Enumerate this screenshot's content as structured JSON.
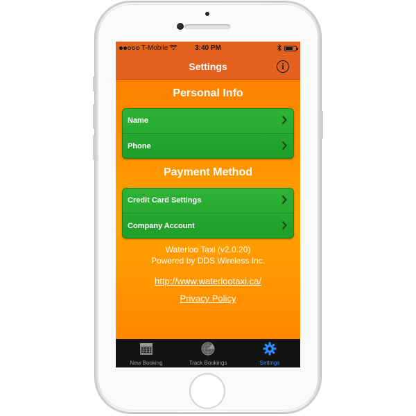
{
  "status_bar": {
    "carrier": "T-Mobile",
    "time": "3:40 PM",
    "signal_bars": 2,
    "battery_level": 0.7
  },
  "nav": {
    "title": "Settings",
    "info_icon": "info-icon"
  },
  "sections": {
    "personal": {
      "title": "Personal Info",
      "rows": [
        "Name",
        "Phone"
      ]
    },
    "payment": {
      "title": "Payment Method",
      "rows": [
        "Credit Card Settings",
        "Company Account"
      ]
    }
  },
  "footer": {
    "version": "Waterloo Taxi (v2.0.20)",
    "powered": "Powered by DDS Wireless Inc.",
    "website": "http://www.waterlootaxi.ca/",
    "privacy": "Privacy Policy"
  },
  "tabs": [
    {
      "label": "New Booking",
      "icon": "calendar-icon",
      "active": false
    },
    {
      "label": "Track Bookings",
      "icon": "radar-icon",
      "active": false
    },
    {
      "label": "Settings",
      "icon": "gear-icon",
      "active": true
    }
  ],
  "colors": {
    "header": "#e2611c",
    "row_green": "#22a12c",
    "tab_active": "#2e8bff"
  }
}
